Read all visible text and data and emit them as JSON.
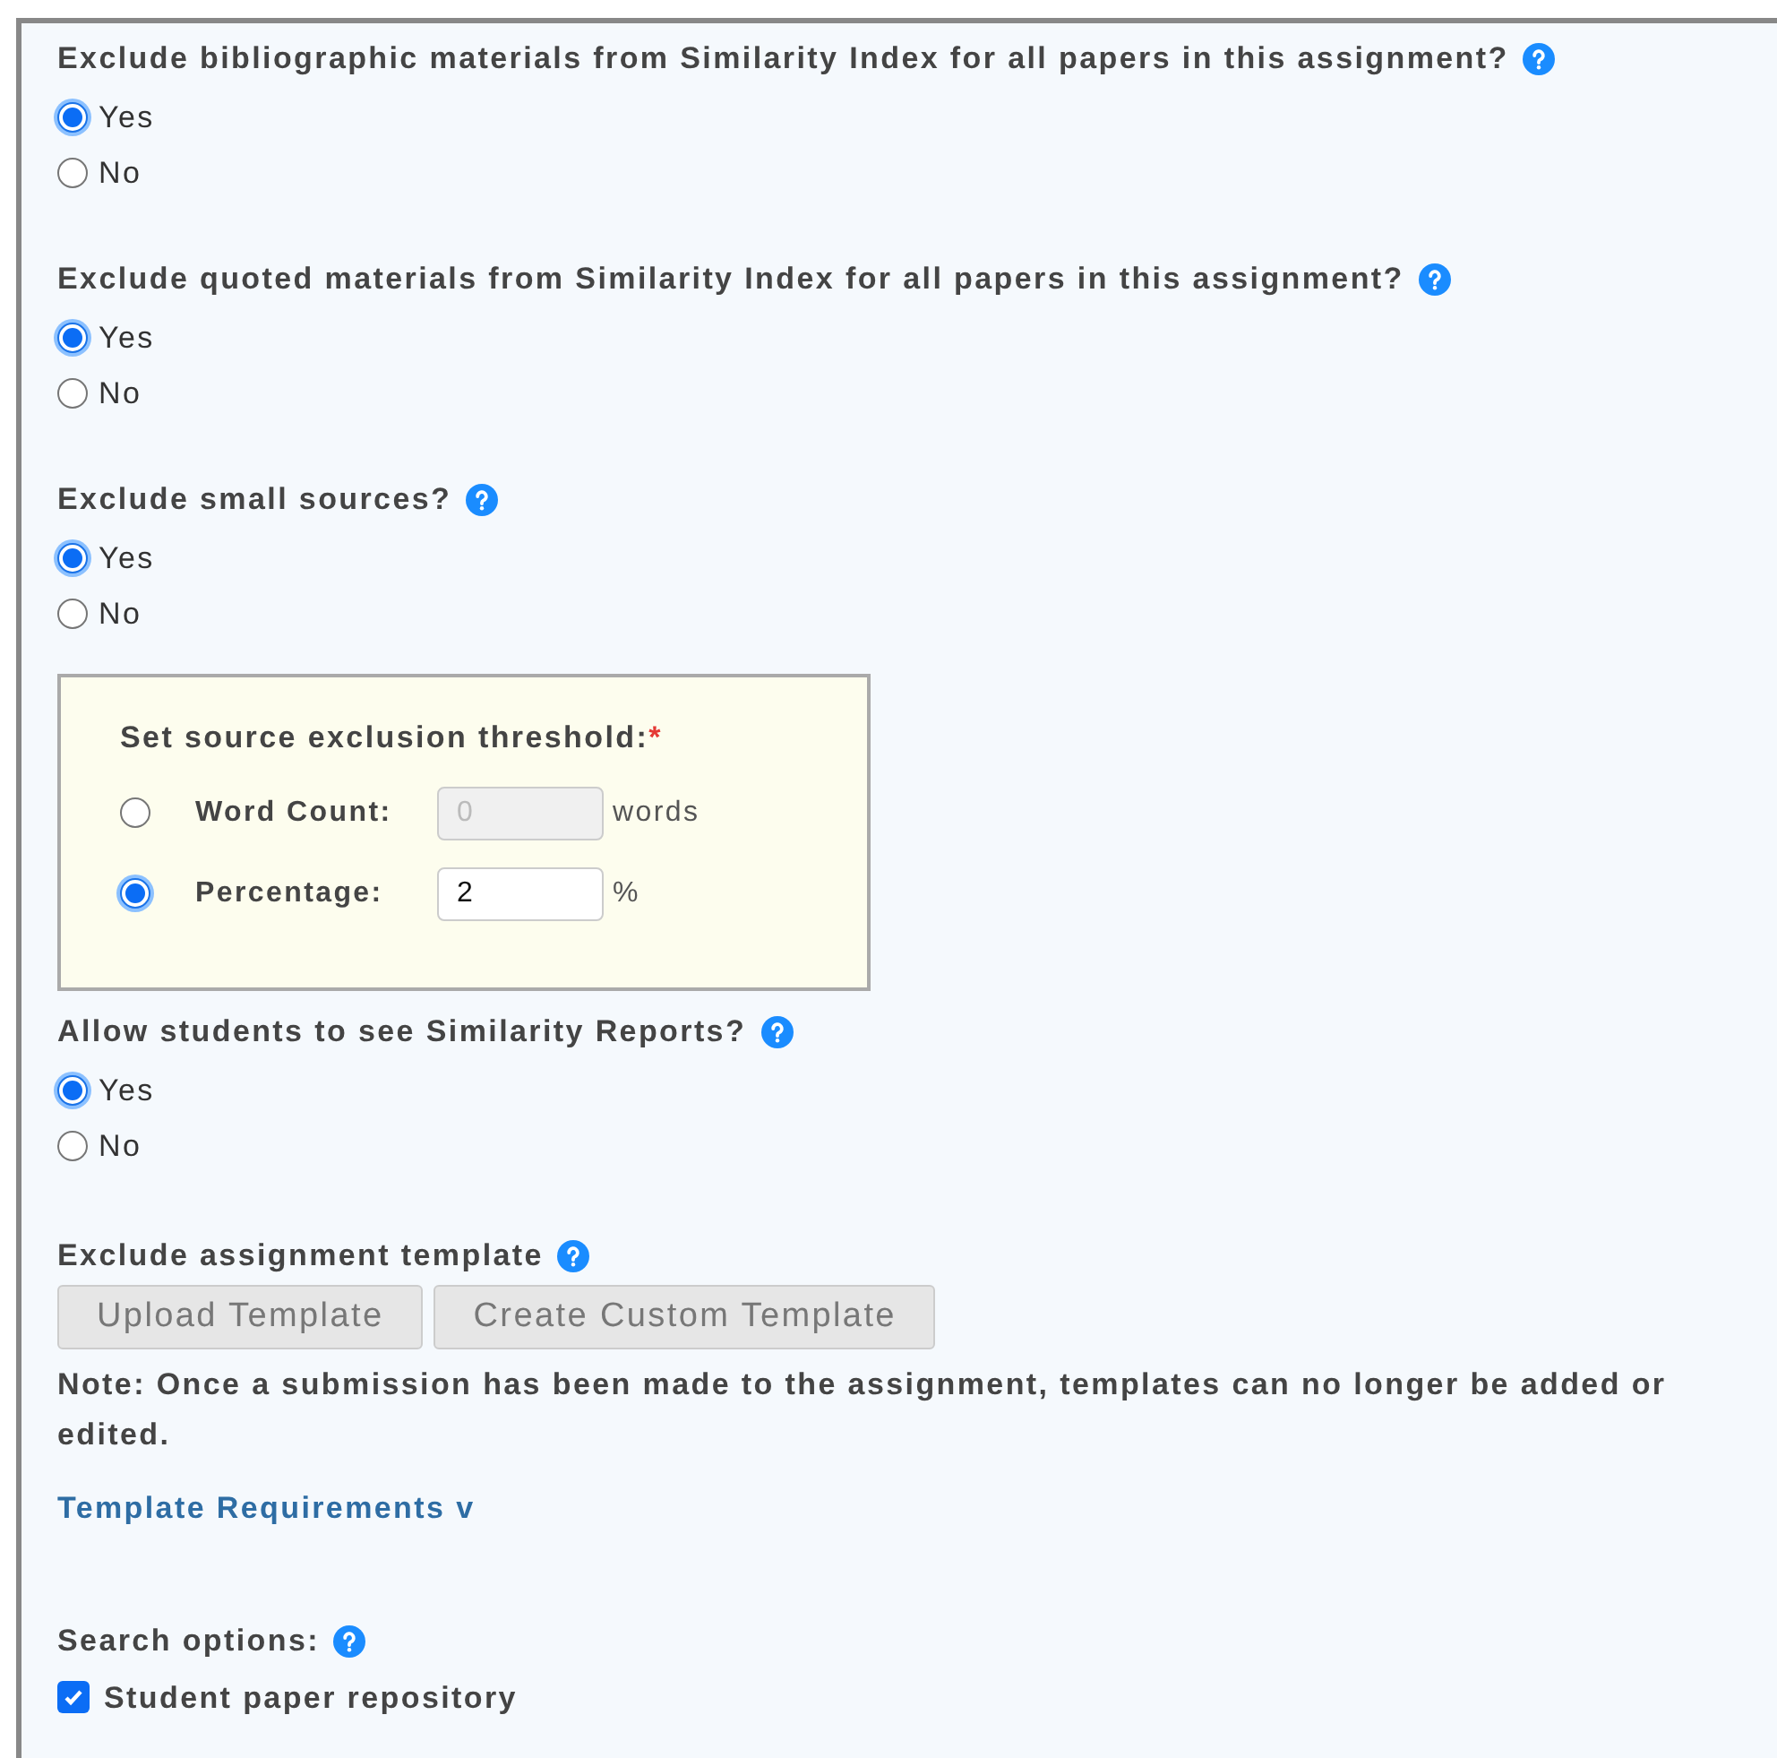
{
  "questions": [
    {
      "label": "Exclude bibliographic materials from Similarity Index for all papers in this assignment?",
      "help": true,
      "options": [
        {
          "label": "Yes",
          "selected": true
        },
        {
          "label": "No",
          "selected": false
        }
      ]
    },
    {
      "label": "Exclude quoted materials from Similarity Index for all papers in this assignment?",
      "help": true,
      "options": [
        {
          "label": "Yes",
          "selected": true
        },
        {
          "label": "No",
          "selected": false
        }
      ]
    },
    {
      "label": "Exclude small sources?",
      "help": true,
      "options": [
        {
          "label": "Yes",
          "selected": true
        },
        {
          "label": "No",
          "selected": false
        }
      ]
    },
    {
      "label": "Allow students to see Similarity Reports?",
      "help": true,
      "options": [
        {
          "label": "Yes",
          "selected": true
        },
        {
          "label": "No",
          "selected": false
        }
      ]
    }
  ],
  "threshold": {
    "title": "Set source exclusion threshold:",
    "required_mark": "*",
    "rows": [
      {
        "label": "Word Count:",
        "value": "0",
        "unit": "words",
        "selected": false,
        "disabled": true
      },
      {
        "label": "Percentage:",
        "value": "2",
        "unit": "%",
        "selected": true,
        "disabled": false
      }
    ]
  },
  "template": {
    "title": "Exclude assignment template",
    "help": true,
    "buttons": [
      "Upload Template",
      "Create Custom Template"
    ],
    "note": "Note: Once a submission has been made to the assignment, templates can no longer be added or edited.",
    "link": "Template Requirements v"
  },
  "search_options": {
    "title": "Search options:",
    "help": true,
    "items": [
      {
        "label": "Student paper repository",
        "checked": true
      }
    ]
  }
}
